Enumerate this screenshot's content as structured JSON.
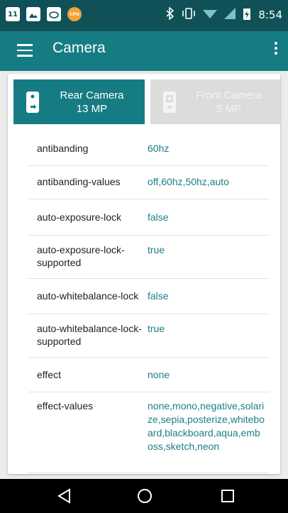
{
  "status_bar": {
    "badge": "11",
    "cpu_label": "CPU",
    "time": "8:54"
  },
  "app_bar": {
    "title": "Camera"
  },
  "tabs": [
    {
      "label": "Rear Camera",
      "sub": "13 MP",
      "selected": true
    },
    {
      "label": "Front Camera",
      "sub": "5 MP",
      "selected": false
    }
  ],
  "params": [
    {
      "key": "antibanding",
      "value": "60hz"
    },
    {
      "key": "antibanding-values",
      "value": "off,60hz,50hz,auto"
    },
    {
      "key": "auto-exposure-lock",
      "value": "false"
    },
    {
      "key": "auto-exposure-lock-supported",
      "value": "true"
    },
    {
      "key": "auto-whitebalance-lock",
      "value": "false"
    },
    {
      "key": "auto-whitebalance-lock-supported",
      "value": "true"
    },
    {
      "key": "effect",
      "value": "none"
    },
    {
      "key": "effect-values",
      "value": "none,mono,negative,solarize,sepia,posterize,whiteboard,blackboard,aqua,emboss,sketch,neon"
    }
  ],
  "colors": {
    "status_bar": "#0f5157",
    "app_bar": "#167c84",
    "accent_text": "#1b7f87",
    "tab_inactive": "#dcdcdc"
  }
}
